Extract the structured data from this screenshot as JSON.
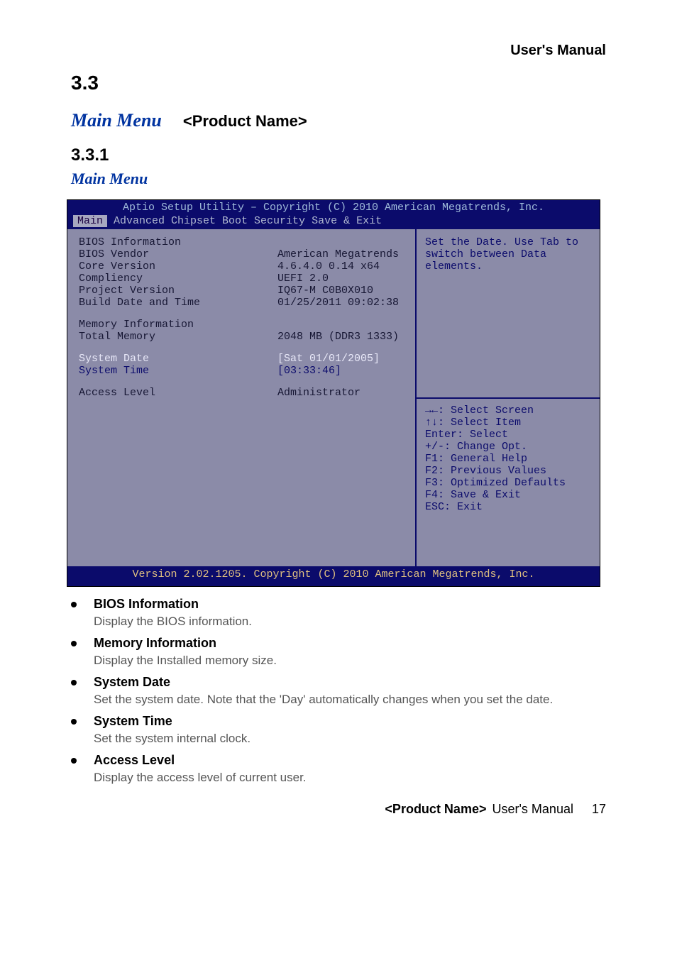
{
  "header": {
    "right": "User's  Manual"
  },
  "section": {
    "num": "3.3",
    "title_blue": "Main Menu",
    "product": "<Product Name>"
  },
  "sub": {
    "num": "3.3.1",
    "title_blue": "Main Menu"
  },
  "bios": {
    "title": "Aptio Setup Utility – Copyright (C) 2010 American Megatrends, Inc.",
    "menu": {
      "sel": "Main",
      "rest": "  Advanced  Chipset  Boot  Security  Save & Exit"
    },
    "help_top1": "Set the Date. Use Tab to",
    "help_top2": "switch between Data elements.",
    "info_hdr": "BIOS Information",
    "rows": [
      {
        "lbl": "BIOS Vendor",
        "val": "American Megatrends"
      },
      {
        "lbl": "Core Version",
        "val": "4.6.4.0   0.14 x64"
      },
      {
        "lbl": "Compliency",
        "val": "UEFI 2.0"
      },
      {
        "lbl": "Project Version",
        "val": "IQ67-M C0B0X010"
      },
      {
        "lbl": "Build Date and Time",
        "val": "01/25/2011 09:02:38"
      }
    ],
    "mem_hdr": "Memory Information",
    "mem_lbl": "Total Memory",
    "mem_val": "2048 MB (DDR3 1333)",
    "date_lbl": "System Date",
    "date_val": "[Sat 01/01/2005]",
    "time_lbl": "System Time",
    "time_val": "[03:33:46]",
    "acc_lbl": "Access Level",
    "acc_val": "Administrator",
    "keys": [
      "→←: Select Screen",
      "↑↓: Select Item",
      "Enter: Select",
      "+/-: Change Opt.",
      "F1: General Help",
      "F2: Previous Values",
      "F3: Optimized Defaults",
      "F4: Save & Exit",
      "ESC: Exit"
    ],
    "foot": "Version 2.02.1205. Copyright (C) 2010 American Megatrends, Inc."
  },
  "bullets": [
    {
      "h": "BIOS Information",
      "d": "Display the BIOS information."
    },
    {
      "h": "Memory Information",
      "d": "Display the Installed memory size."
    },
    {
      "h": "System Date",
      "d": "Set the system date. Note that the 'Day' automatically changes when you set the date."
    },
    {
      "h": "System Time",
      "d": "Set the system internal clock."
    },
    {
      "h": "Access Level",
      "d": "Display the access level of current user."
    }
  ],
  "footer": {
    "model": "<Product Name>",
    "label": " User's Manual",
    "page": "17"
  }
}
